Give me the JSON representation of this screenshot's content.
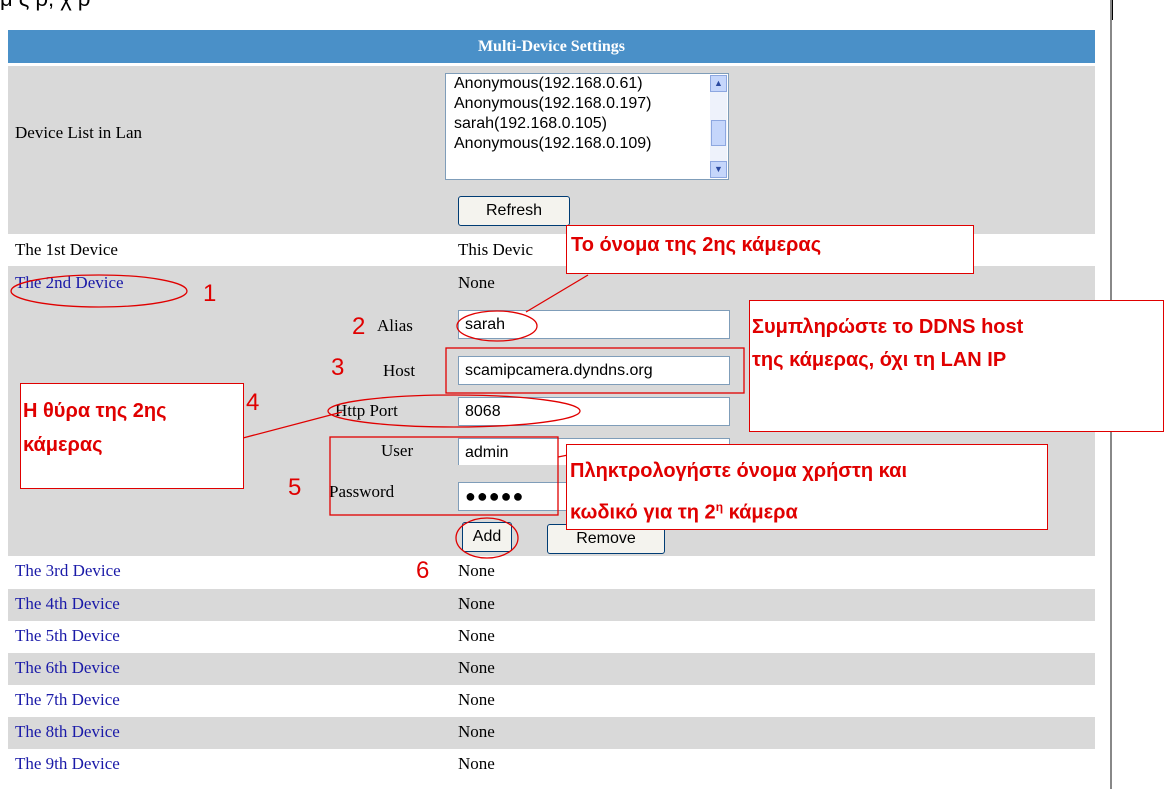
{
  "top_text": "μ ς ρ, χ ρ",
  "panel": {
    "title": "Multi-Device Settings",
    "device_list_label": "Device List in Lan",
    "device_list": [
      "Anonymous(192.168.0.61)",
      "Anonymous(192.168.0.197)",
      "sarah(192.168.0.105)",
      "Anonymous(192.168.0.109)"
    ],
    "refresh_label": "Refresh",
    "device1": {
      "label": "The 1st Device",
      "value": "This Devic"
    },
    "device2": {
      "label": "The 2nd Device",
      "value": "None"
    },
    "form": {
      "alias_label": "Alias",
      "alias_value": "sarah",
      "host_label": "Host",
      "host_value": "scamipcamera.dyndns.org",
      "port_label": "Http Port",
      "port_value": "8068",
      "user_label": "User",
      "user_value": "admin",
      "password_label": "Password",
      "password_value": "●●●●●",
      "add_label": "Add",
      "remove_label": "Remove"
    },
    "devices": [
      {
        "label": "The 3rd Device",
        "value": "None"
      },
      {
        "label": "The 4th Device",
        "value": "None"
      },
      {
        "label": "The 5th Device",
        "value": "None"
      },
      {
        "label": "The 6th Device",
        "value": "None"
      },
      {
        "label": "The 7th Device",
        "value": "None"
      },
      {
        "label": "The 8th Device",
        "value": "None"
      },
      {
        "label": "The 9th Device",
        "value": "None"
      }
    ]
  },
  "annotations": {
    "numbers": [
      "1",
      "2",
      "3",
      "4",
      "5",
      "6"
    ],
    "callout_name": "Το όνομα της 2ης κάμερας",
    "callout_ddns_line1": "Συμπληρώστε το DDNS host",
    "callout_ddns_line2": "της κάμερας, όχι τη LAN IP",
    "callout_port_line1": "Η θύρα της 2ης",
    "callout_port_line2": "κάμερας",
    "callout_user_line1": "Πληκτρολογήστε όνομα χρήστη και",
    "callout_user_line2_pre": "κωδικό για τη 2",
    "callout_user_sup": "η",
    "callout_user_line2_post": " κάμερα",
    "color": "#e00000"
  }
}
